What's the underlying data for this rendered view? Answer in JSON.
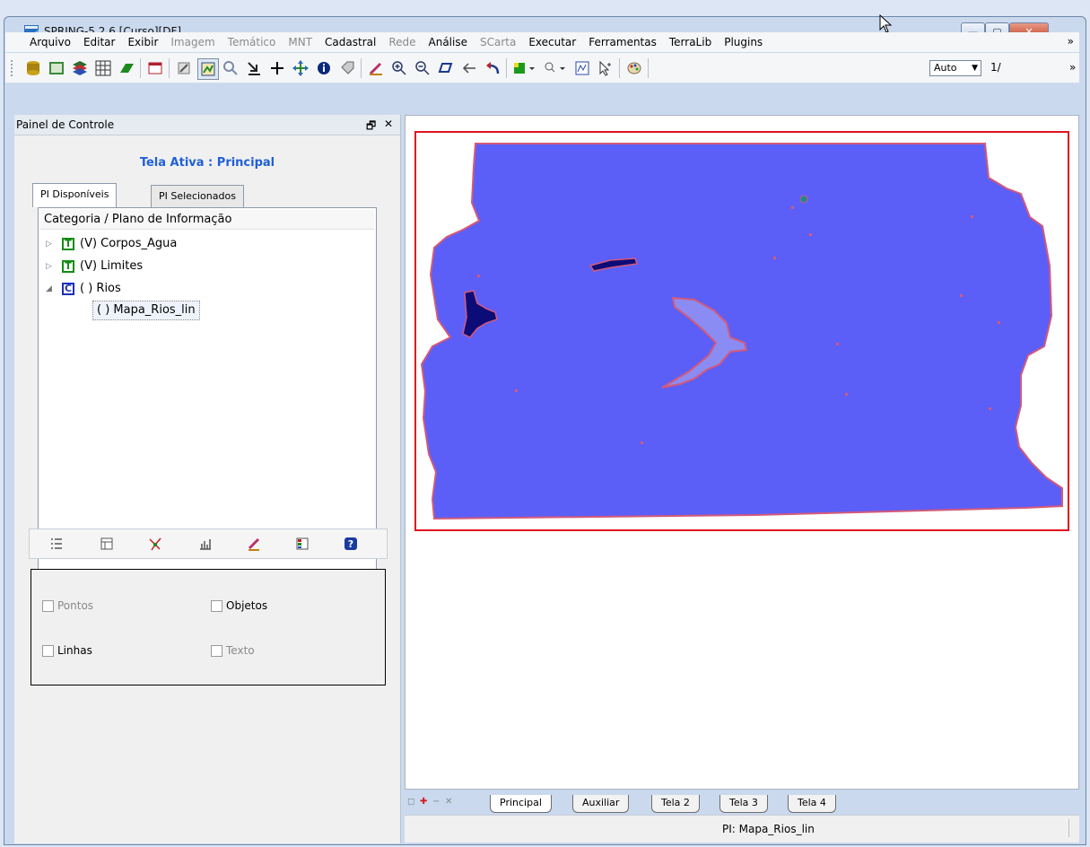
{
  "window": {
    "title": "SPRING-5.2.6 [Curso][DF]",
    "controls": {
      "minimize": "—",
      "maximize": "▢",
      "close": "✕"
    }
  },
  "menu": {
    "items": [
      {
        "label": "Arquivo",
        "enabled": true
      },
      {
        "label": "Editar",
        "enabled": true
      },
      {
        "label": "Exibir",
        "enabled": true
      },
      {
        "label": "Imagem",
        "enabled": false
      },
      {
        "label": "Temático",
        "enabled": false
      },
      {
        "label": "MNT",
        "enabled": false
      },
      {
        "label": "Cadastral",
        "enabled": true
      },
      {
        "label": "Rede",
        "enabled": false
      },
      {
        "label": "Análise",
        "enabled": true
      },
      {
        "label": "SCarta",
        "enabled": false
      },
      {
        "label": "Executar",
        "enabled": true
      },
      {
        "label": "Ferramentas",
        "enabled": true
      },
      {
        "label": "TerraLib",
        "enabled": true
      },
      {
        "label": "Plugins",
        "enabled": true
      }
    ],
    "overflow": "»"
  },
  "toolbar": {
    "zoom_value": "Auto",
    "scale_prefix": "1/",
    "overflow": "»"
  },
  "control_panel": {
    "title": "Painel de Controle",
    "pin": "🗗",
    "close": "✕",
    "active_screen": "Tela Ativa : Principal",
    "tabs": [
      "PI Disponíveis",
      "PI Selecionados"
    ],
    "tree_header": "Categoria / Plano de Informação",
    "tree": [
      {
        "type": "T",
        "label": "(V) Corpos_Agua",
        "expander": "▷"
      },
      {
        "type": "T",
        "label": "(V) Limites",
        "expander": "▷"
      },
      {
        "type": "C",
        "label": "( ) Rios",
        "expander": "◢"
      },
      {
        "type": "child",
        "label": "( ) Mapa_Rios_lin"
      }
    ],
    "visual": {
      "pontos": "Pontos",
      "objetos": "Objetos",
      "linhas": "Linhas",
      "texto": "Texto"
    }
  },
  "screen_tabs": [
    "Principal",
    "Auxiliar",
    "Tela 2",
    "Tela 3",
    "Tela 4"
  ],
  "status": {
    "pi": "PI: Mapa_Rios_lin"
  },
  "colors": {
    "map_fill": "#5c5ef8",
    "map_border": "#d35a7a",
    "frame": "#e0141e",
    "water_dark": "#0c0c78",
    "title_link": "#1f5fd8"
  }
}
